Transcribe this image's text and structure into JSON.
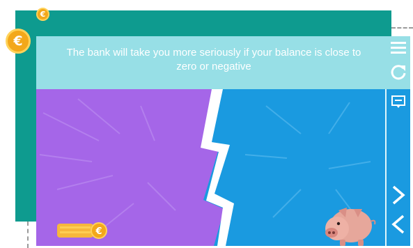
{
  "game": {
    "message": "The bank will take you more seriously if your balance is close to zero or negative",
    "coin_symbol": "€"
  },
  "colors": {
    "teal": "#0e9b8f",
    "banner": "#97dfe6",
    "purple": "#a566e8",
    "blue": "#1a9ae0",
    "coin": "#f3a81a"
  },
  "controls": {
    "menu": "hamburger-menu-icon",
    "restart": "refresh-icon",
    "chat": "chat-icon",
    "next": "chevron-right-icon",
    "back": "chevron-left-icon"
  }
}
